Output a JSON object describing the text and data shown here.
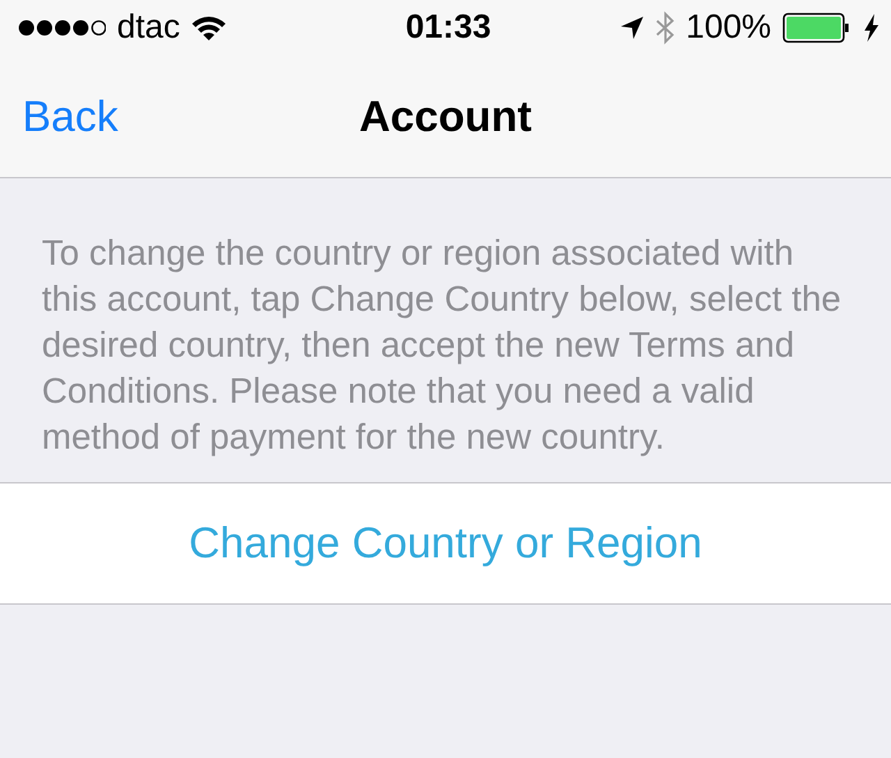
{
  "status_bar": {
    "carrier": "dtac",
    "time": "01:33",
    "battery": "100%"
  },
  "nav_bar": {
    "back": "Back",
    "title": "Account"
  },
  "description": "To change the country or region associated with this account, tap Change Country below, select the desired country, then accept the new Terms and Conditions. Please note that you need a valid method of payment for the new country.",
  "action": {
    "label": "Change Country or Region"
  }
}
